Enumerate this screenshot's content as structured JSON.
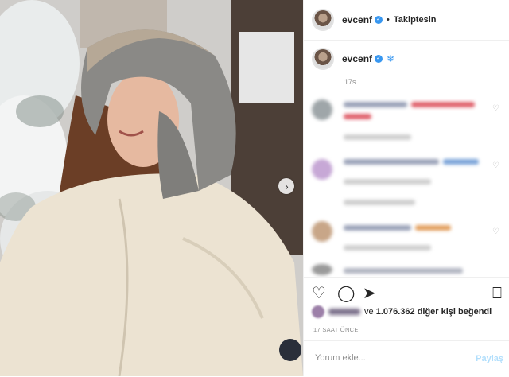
{
  "header": {
    "username": "evcenf",
    "separator": "•",
    "follow_status": "Takiptesin"
  },
  "caption": {
    "username": "evcenf",
    "emoji": "❄",
    "time": "17s"
  },
  "actions": {
    "like_icon": "heart-icon",
    "comment_icon": "comment-icon",
    "share_icon": "share-icon",
    "save_icon": "bookmark-icon"
  },
  "likes": {
    "prefix": "ve",
    "count": "1.076.362",
    "suffix": "diğer kişi beğendi"
  },
  "time_ago": "17 SAAT ÖNCE",
  "comment_input": {
    "placeholder": "Yorum ekle...",
    "post_label": "Paylaş"
  },
  "photo": {
    "next_icon": "chevron-right-icon"
  }
}
